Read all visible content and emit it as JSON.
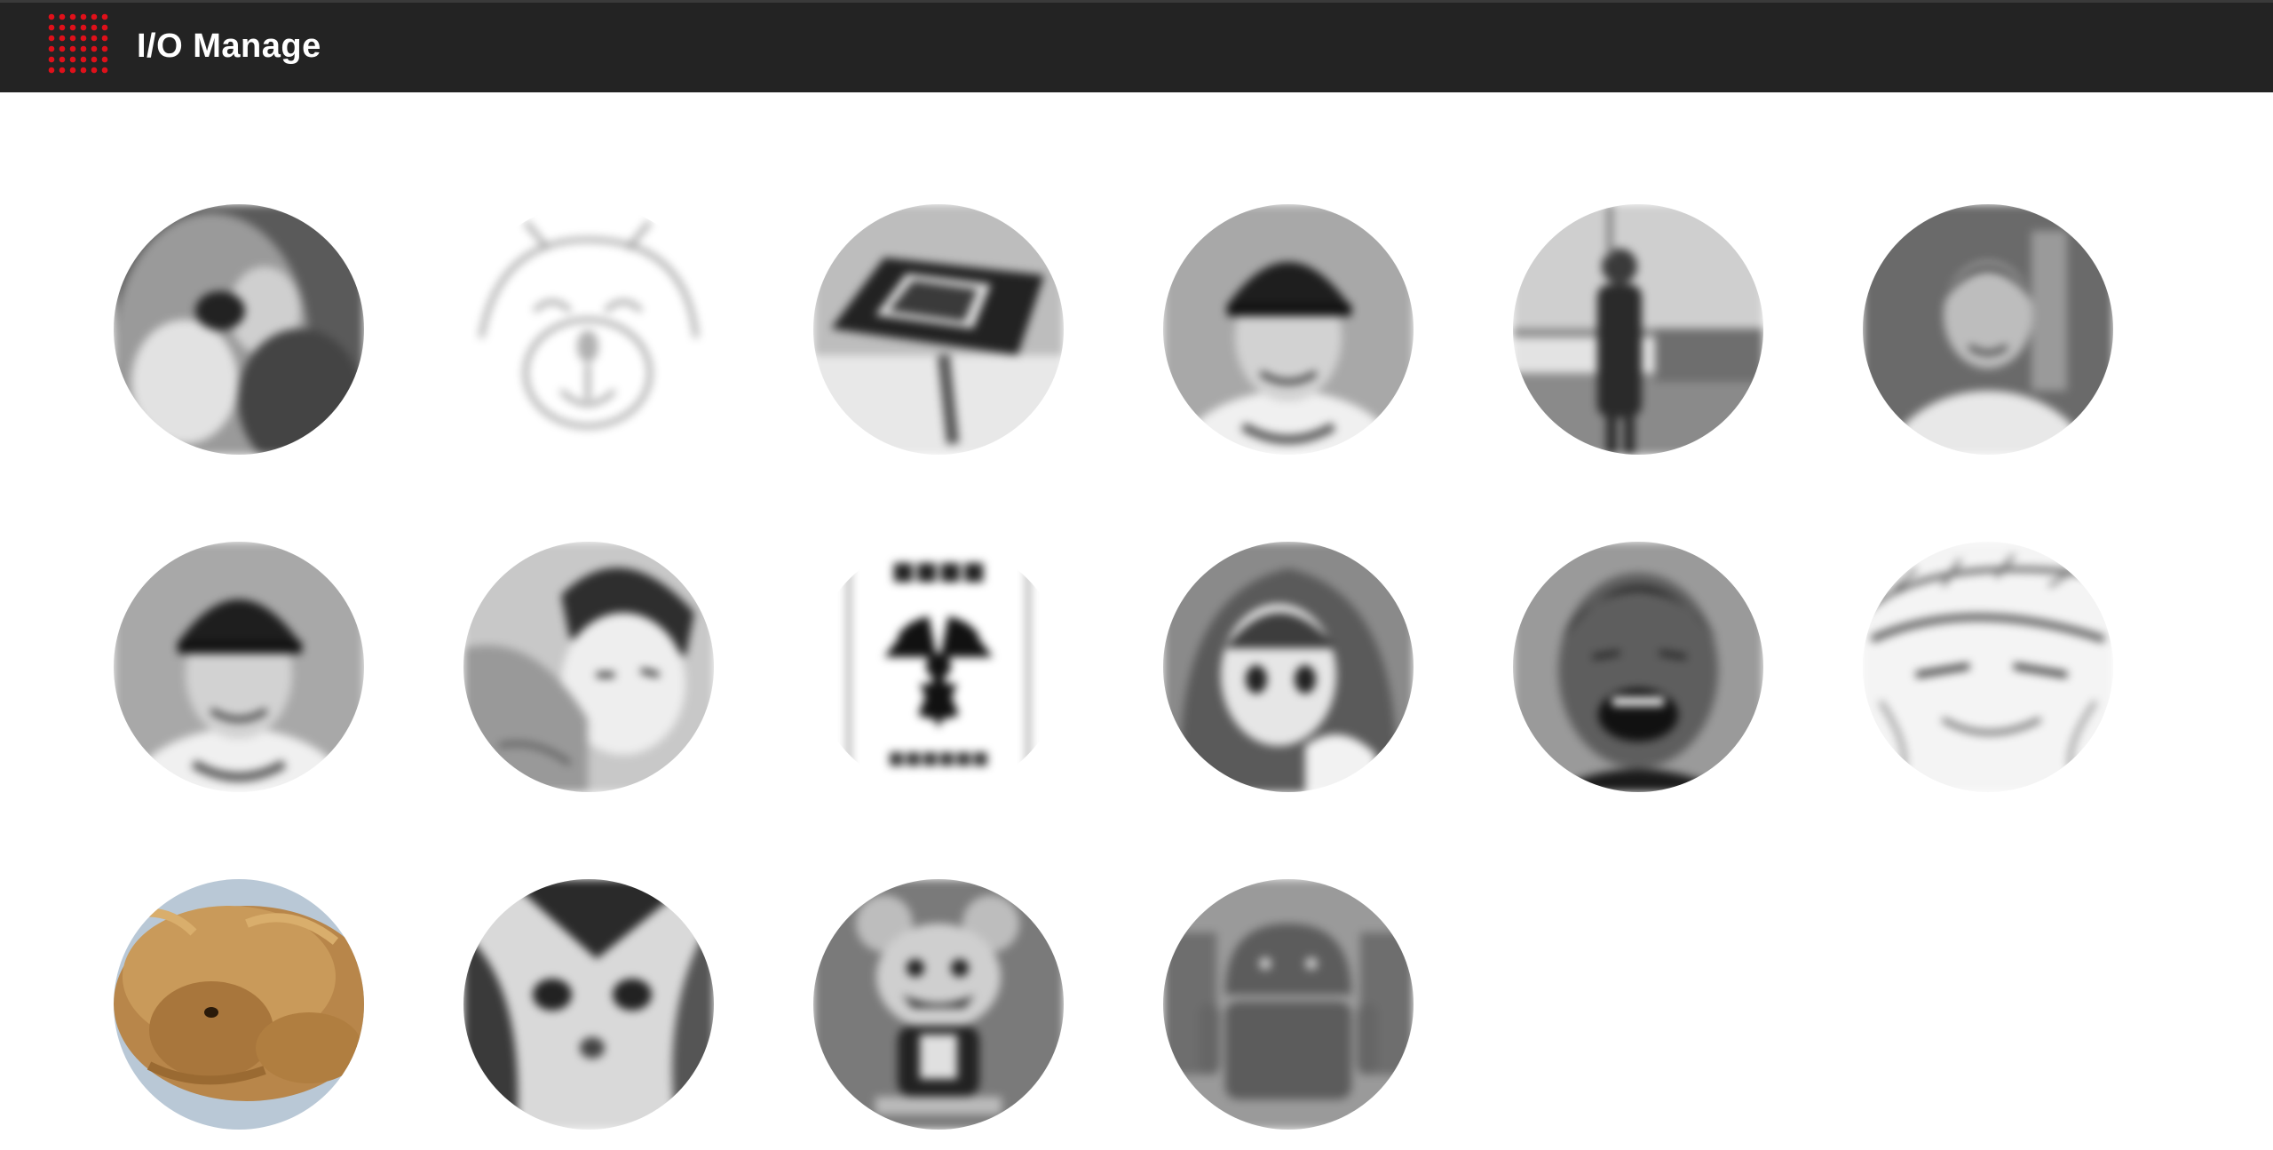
{
  "app": {
    "title": "I/O Manage",
    "logo_icon": "red-dot-grid-icon",
    "accent_color": "#e0101a",
    "header_bg": "#232323"
  },
  "avatars": [
    {
      "name": "avatar-cat-photo",
      "style": "grayscale",
      "icon": "cat-photo"
    },
    {
      "name": "avatar-sketch-drawing",
      "style": "grayscale",
      "icon": "bear-sketch"
    },
    {
      "name": "avatar-tablet-device",
      "style": "grayscale",
      "icon": "tablet-device"
    },
    {
      "name": "avatar-baseball-player",
      "style": "grayscale",
      "icon": "person-cap"
    },
    {
      "name": "avatar-outdoor-person",
      "style": "grayscale",
      "icon": "person-outdoor"
    },
    {
      "name": "avatar-office-person",
      "style": "grayscale",
      "icon": "person-shirt"
    },
    {
      "name": "avatar-baseball-player-2",
      "style": "grayscale",
      "icon": "person-cap"
    },
    {
      "name": "avatar-anime-character",
      "style": "grayscale",
      "icon": "anime-character"
    },
    {
      "name": "avatar-radiation-sign",
      "style": "grayscale",
      "icon": "radiation-symbol"
    },
    {
      "name": "avatar-anime-hood",
      "style": "grayscale",
      "icon": "anime-hood"
    },
    {
      "name": "avatar-laughing-man",
      "style": "grayscale",
      "icon": "person-laughing"
    },
    {
      "name": "avatar-manga-sketch",
      "style": "grayscale",
      "icon": "manga-face"
    },
    {
      "name": "avatar-plush-dog",
      "style": "color-selected",
      "icon": "plush-toy"
    },
    {
      "name": "avatar-cat-closeup",
      "style": "grayscale",
      "icon": "cat-face"
    },
    {
      "name": "avatar-mouse-figure",
      "style": "grayscale",
      "icon": "mouse-figure"
    },
    {
      "name": "avatar-android-robot",
      "style": "grayscale",
      "icon": "android-robot"
    }
  ]
}
